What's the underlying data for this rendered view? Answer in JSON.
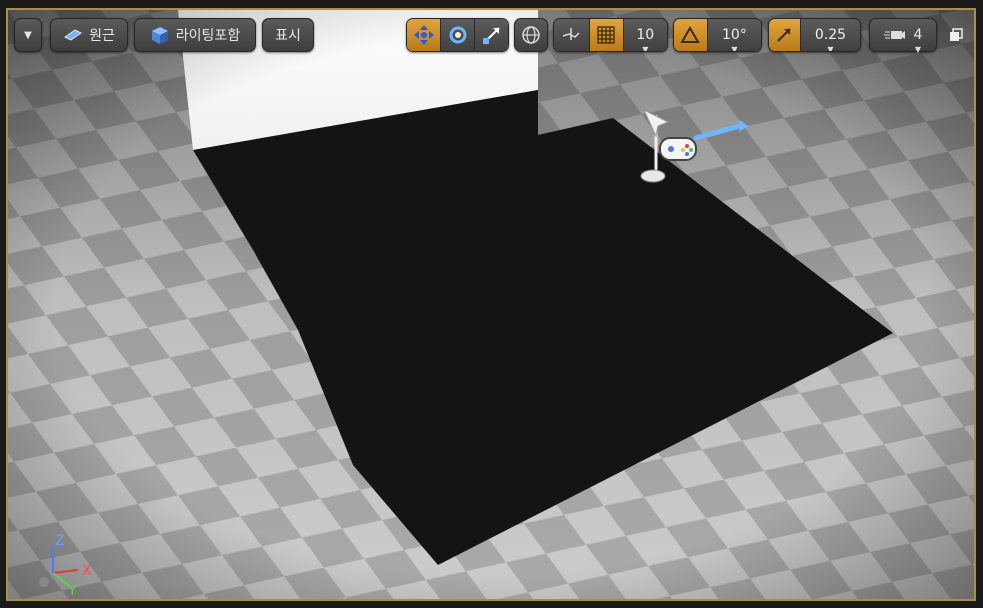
{
  "toolbar": {
    "view_mode_label": "원근",
    "lighting_label": "라이팅포함",
    "show_label": "표시",
    "grid_snap_value": "10",
    "rotation_snap_value": "10°",
    "scale_snap_value": "0.25",
    "camera_speed_value": "4",
    "icons": {
      "menu": "dropdown-arrow-icon",
      "perspective": "perspective-cube-icon",
      "lighting": "lit-sphere-cube-icon",
      "translate": "move-arrows-icon",
      "rotate": "rotate-icon",
      "scale": "scale-icon",
      "world": "globe-icon",
      "surface_snap": "surface-snap-icon",
      "grid": "grid-icon",
      "rotation": "angle-triangle-icon",
      "scale_snap": "scale-arrow-icon",
      "camera": "camera-speed-icon",
      "maximize": "maximize-viewport-icon"
    }
  },
  "axis_gizmo": {
    "z_label": "Z",
    "x_label": "X",
    "y_label": "Y"
  },
  "colors": {
    "accent_orange": "#d9952c",
    "viewport_border": "#a8904a",
    "x_axis": "#e03a3a",
    "y_axis": "#5ed34e",
    "z_axis": "#4a78ff"
  }
}
